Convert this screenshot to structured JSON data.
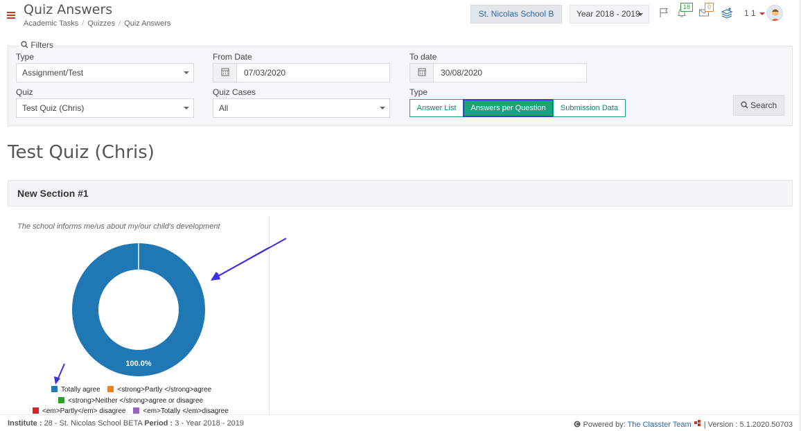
{
  "header": {
    "title": "Quiz Answers",
    "breadcrumb": [
      "Academic Tasks",
      "Quizzes",
      "Quiz Answers"
    ],
    "school": "St. Nicolas School B",
    "year": "Year 2018 - 2019",
    "notifications_count": "18",
    "messages_count": "0",
    "user_label": "1 1"
  },
  "filters": {
    "legend": "Filters",
    "type_label": "Type",
    "type_value": "Assignment/Test",
    "from_label": "From Date",
    "from_value": "07/03/2020",
    "to_label": "To date",
    "to_value": "30/08/2020",
    "quiz_label": "Quiz",
    "quiz_value": "Test Quiz (Chris)",
    "cases_label": "Quiz Cases",
    "cases_value": "All",
    "view_type_label": "Type",
    "view_buttons": [
      "Answer List",
      "Answers per Question",
      "Submission Data"
    ],
    "search_label": "Search"
  },
  "main": {
    "quiz_title": "Test Quiz (Chris)",
    "section_title": "New Section #1",
    "question": "The school informs me/us about my/our child's development"
  },
  "chart_data": {
    "type": "pie",
    "title": "The school informs me/us about my/our child's development",
    "labels": [
      "Totally agree",
      "<strong>Partly </strong>agree",
      "<strong>Neither </strong>agree or disagree",
      "<em>Partly</em> disagree",
      "<em>Totally </em>disagree"
    ],
    "values": [
      100.0,
      0,
      0,
      0,
      0
    ],
    "slice_label": "100.0%",
    "colors": [
      "#1f77b4",
      "#ff7f0e",
      "#2ca02c",
      "#d62728",
      "#9467bd"
    ],
    "donut": true,
    "legend_position": "bottom"
  },
  "footer": {
    "institute_label": "Institute :",
    "institute_value": "28 - St. Nicolas School BETA",
    "period_label": "Period :",
    "period_value": "3 - Year 2018 - 2019",
    "powered_by": "Powered by:",
    "team": "The Classter Team",
    "version": "| Version : 5.1.2020.50703"
  }
}
